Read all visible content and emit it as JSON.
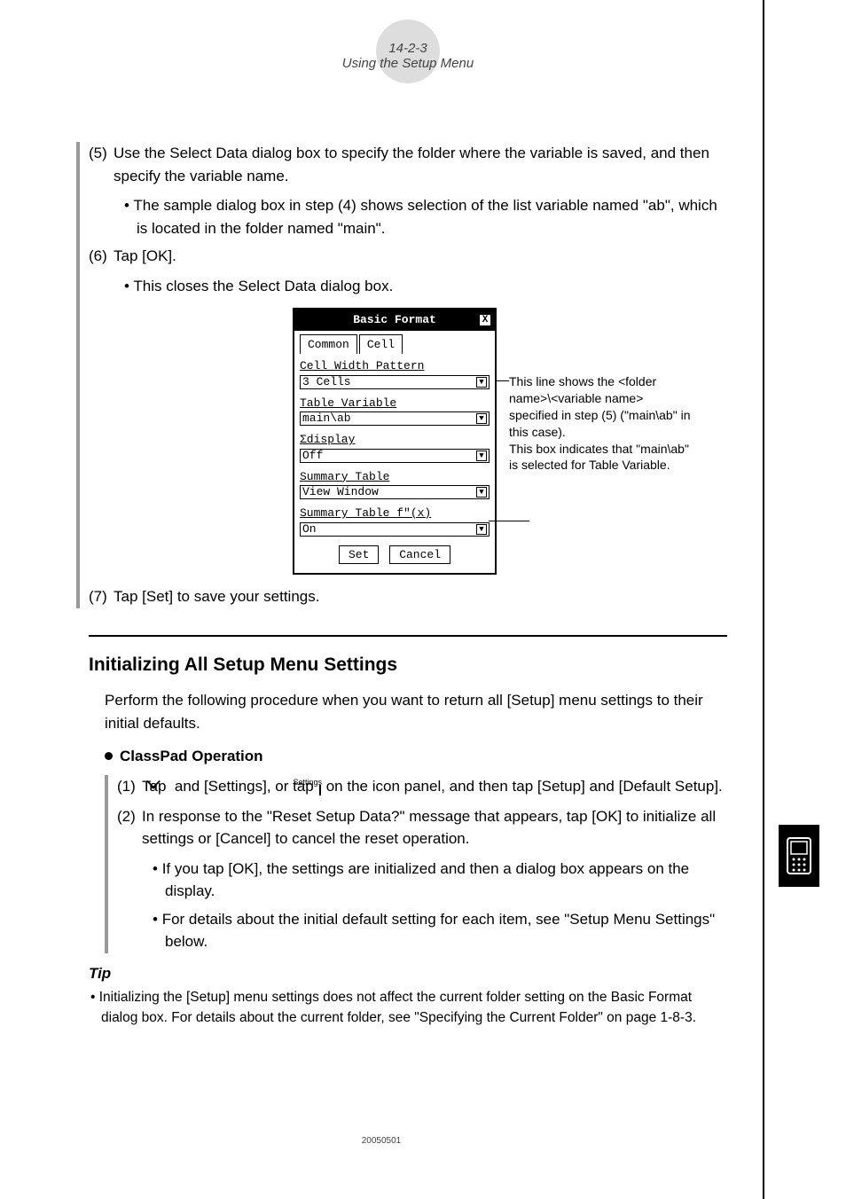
{
  "header": {
    "page_ref": "14-2-3",
    "section": "Using the Setup Menu"
  },
  "steps_top": {
    "s5": "Use the Select Data dialog box to specify the folder where the variable is saved, and then specify the variable name.",
    "s5_b1": "The sample dialog box in step (4) shows selection of the list variable named \"ab\", which is located in the folder named \"main\".",
    "s6": "Tap [OK].",
    "s6_b1": "This closes the Select Data dialog box."
  },
  "dialog": {
    "title": "Basic Format",
    "tab1": "Common",
    "tab2": "Cell",
    "f1_label": "Cell Width Pattern",
    "f1_value": "3 Cells",
    "f2_label": "Table Variable",
    "f2_value": "main\\ab",
    "f3_label": "Σdisplay",
    "f3_value": "Off",
    "f4_label": "Summary Table",
    "f4_value": "View Window",
    "f5_label": "Summary Table f\"(x)",
    "f5_value": "On",
    "btn_set": "Set",
    "btn_cancel": "Cancel"
  },
  "annotation": {
    "line1": "This line shows the <folder name>\\<variable name> specified in step (5) (\"main\\ab\" in this case).",
    "line2": "This box indicates that \"main\\ab\" is selected for Table Variable."
  },
  "steps_after": {
    "s7": "Tap [Set] to save your settings."
  },
  "section2": {
    "heading": "Initializing All Setup Menu Settings",
    "intro": "Perform the following procedure when you want to return all [Setup] menu settings to their initial defaults.",
    "op_head": "ClassPad Operation",
    "s1_a": "Tap ",
    "s1_b": " and [Settings], or tap ",
    "s1_c": " on the icon panel, and then tap [Setup] and [Default Setup].",
    "s2": "In response to the \"Reset Setup Data?\" message that appears, tap [OK] to initialize all settings or [Cancel] to cancel the reset operation.",
    "s2_b1": "If you tap [OK], the settings are initialized and then a dialog box appears on the display.",
    "s2_b2": "For details about the initial default setting for each item, see \"Setup Menu Settings\" below.",
    "settings_label": "Settings"
  },
  "tip": {
    "head": "Tip",
    "item": "Initializing the [Setup] menu settings does not affect the current folder setting on the Basic Format dialog box. For details about the current folder, see \"Specifying the Current Folder\" on page 1-8-3."
  },
  "footer": "20050501"
}
